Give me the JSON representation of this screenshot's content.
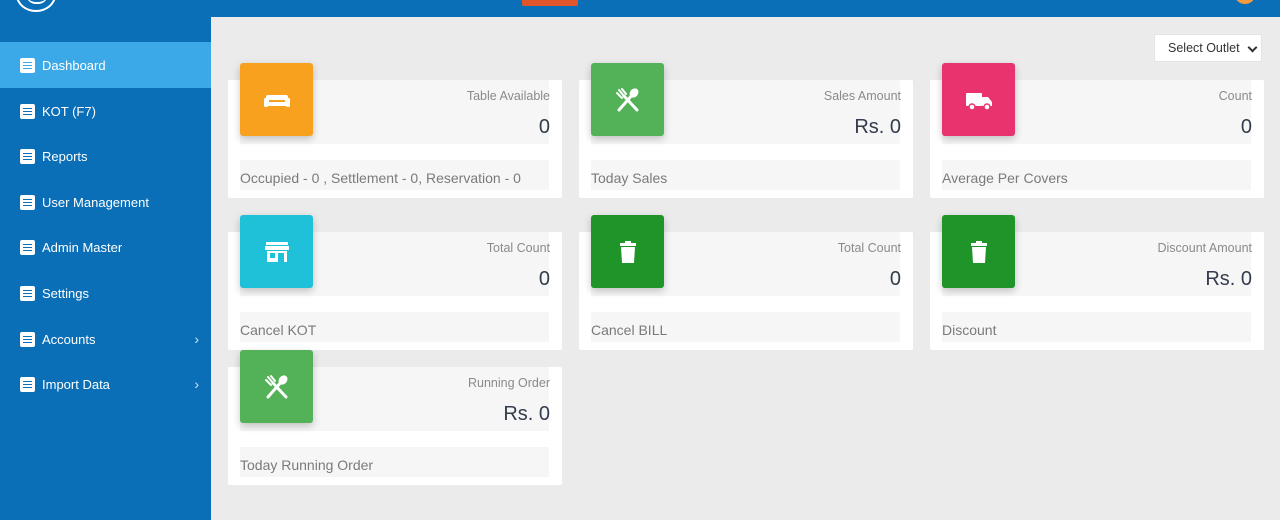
{
  "colors": {
    "topbar": "#0a6fb7",
    "sidebar": "#0a6fb7",
    "sidebar_active": "#3ba8e8",
    "orange": "#f7a11f",
    "green": "#53b157",
    "pink": "#e8336e",
    "cyan": "#1fc1d9",
    "dark_green": "#1f9428"
  },
  "sidebar": {
    "items": [
      {
        "label": "Dashboard",
        "active": true,
        "icon": "list-icon"
      },
      {
        "label": "KOT (F7)",
        "icon": "list-icon"
      },
      {
        "label": "Reports",
        "icon": "list-icon"
      },
      {
        "label": "User Management",
        "icon": "list-icon"
      },
      {
        "label": "Admin Master",
        "icon": "list-icon"
      },
      {
        "label": "Settings",
        "icon": "list-icon"
      },
      {
        "label": "Accounts",
        "icon": "list-icon",
        "chevron": "›"
      },
      {
        "label": "Import Data",
        "icon": "list-icon",
        "chevron": "›"
      }
    ]
  },
  "outlet_select": {
    "value": "Select Outlet"
  },
  "cards": [
    {
      "icon": "sofa-icon",
      "color": "orange",
      "label": "Table Available",
      "value": "0",
      "footer": "Occupied - 0 , Settlement - 0, Reservation - 0"
    },
    {
      "icon": "fork-spoon-icon",
      "color": "green",
      "label": "Sales Amount",
      "value": "Rs. 0",
      "footer": "Today Sales"
    },
    {
      "icon": "truck-icon",
      "color": "pink",
      "label": "Count",
      "value": "0",
      "footer": "Average Per Covers"
    },
    {
      "icon": "store-icon",
      "color": "cyan",
      "label": "Total Count",
      "value": "0",
      "footer": "Cancel KOT"
    },
    {
      "icon": "trash-icon",
      "color": "dark_green",
      "label": "Total Count",
      "value": "0",
      "footer": "Cancel BILL"
    },
    {
      "icon": "trash-icon",
      "color": "dark_green",
      "label": "Discount Amount",
      "value": "Rs. 0",
      "footer": "Discount"
    },
    {
      "icon": "fork-spoon-icon",
      "color": "green",
      "label": "Running Order",
      "value": "Rs. 0",
      "footer": "Today Running Order"
    }
  ]
}
